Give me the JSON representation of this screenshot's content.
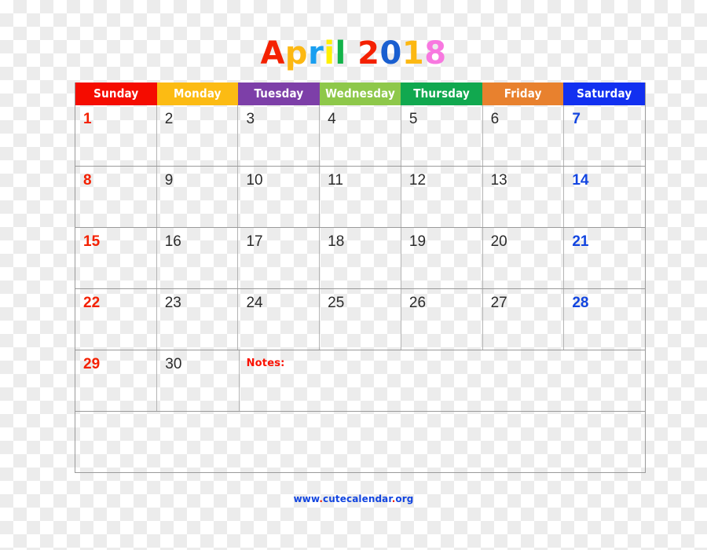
{
  "title": {
    "text": "April 2018",
    "letters": [
      {
        "ch": "A",
        "color": "#f42000"
      },
      {
        "ch": "p",
        "color": "#fcb813"
      },
      {
        "ch": "r",
        "color": "#1a9ff0"
      },
      {
        "ch": "i",
        "color": "#fff000"
      },
      {
        "ch": "l",
        "color": "#13b34a"
      },
      {
        "ch": " ",
        "color": "#000000"
      },
      {
        "ch": "2",
        "color": "#f42000"
      },
      {
        "ch": "0",
        "color": "#1a5fd0"
      },
      {
        "ch": "1",
        "color": "#fcb813"
      },
      {
        "ch": "8",
        "color": "#f878e0"
      }
    ]
  },
  "header": {
    "days": [
      {
        "label": "Sunday",
        "bg": "#f50c00"
      },
      {
        "label": "Monday",
        "bg": "#fcbb13"
      },
      {
        "label": "Tuesday",
        "bg": "#7d3fa8"
      },
      {
        "label": "Wednesday",
        "bg": "#8ec84a"
      },
      {
        "label": "Thursday",
        "bg": "#11a84f"
      },
      {
        "label": "Friday",
        "bg": "#e8812e"
      },
      {
        "label": "Saturday",
        "bg": "#1230f0"
      }
    ]
  },
  "weeks": [
    {
      "cells": [
        {
          "num": "1",
          "kind": "sun"
        },
        {
          "num": "2",
          "kind": "weekday"
        },
        {
          "num": "3",
          "kind": "weekday"
        },
        {
          "num": "4",
          "kind": "weekday"
        },
        {
          "num": "5",
          "kind": "weekday"
        },
        {
          "num": "6",
          "kind": "weekday"
        },
        {
          "num": "7",
          "kind": "sat"
        }
      ]
    },
    {
      "cells": [
        {
          "num": "8",
          "kind": "sun"
        },
        {
          "num": "9",
          "kind": "weekday"
        },
        {
          "num": "10",
          "kind": "weekday"
        },
        {
          "num": "11",
          "kind": "weekday"
        },
        {
          "num": "12",
          "kind": "weekday"
        },
        {
          "num": "13",
          "kind": "weekday"
        },
        {
          "num": "14",
          "kind": "sat"
        }
      ]
    },
    {
      "cells": [
        {
          "num": "15",
          "kind": "sun"
        },
        {
          "num": "16",
          "kind": "weekday"
        },
        {
          "num": "17",
          "kind": "weekday"
        },
        {
          "num": "18",
          "kind": "weekday"
        },
        {
          "num": "19",
          "kind": "weekday"
        },
        {
          "num": "20",
          "kind": "weekday"
        },
        {
          "num": "21",
          "kind": "sat"
        }
      ]
    },
    {
      "cells": [
        {
          "num": "22",
          "kind": "sun"
        },
        {
          "num": "23",
          "kind": "weekday"
        },
        {
          "num": "24",
          "kind": "weekday"
        },
        {
          "num": "25",
          "kind": "weekday"
        },
        {
          "num": "26",
          "kind": "weekday"
        },
        {
          "num": "27",
          "kind": "weekday"
        },
        {
          "num": "28",
          "kind": "sat"
        }
      ]
    }
  ],
  "last_week": {
    "cells": [
      {
        "num": "29",
        "kind": "sun"
      },
      {
        "num": "30",
        "kind": "weekday"
      }
    ],
    "notes_label": "Notes:"
  },
  "footer": {
    "parts": [
      {
        "text": "www",
        "color": "#1245e0"
      },
      {
        "text": ".",
        "color": "#f42000"
      },
      {
        "text": "cutecalendar",
        "color": "#1245e0"
      },
      {
        "text": ".",
        "color": "#f42000"
      },
      {
        "text": "org",
        "color": "#1245e0"
      }
    ],
    "full_text": "www.cutecalendar.org"
  }
}
